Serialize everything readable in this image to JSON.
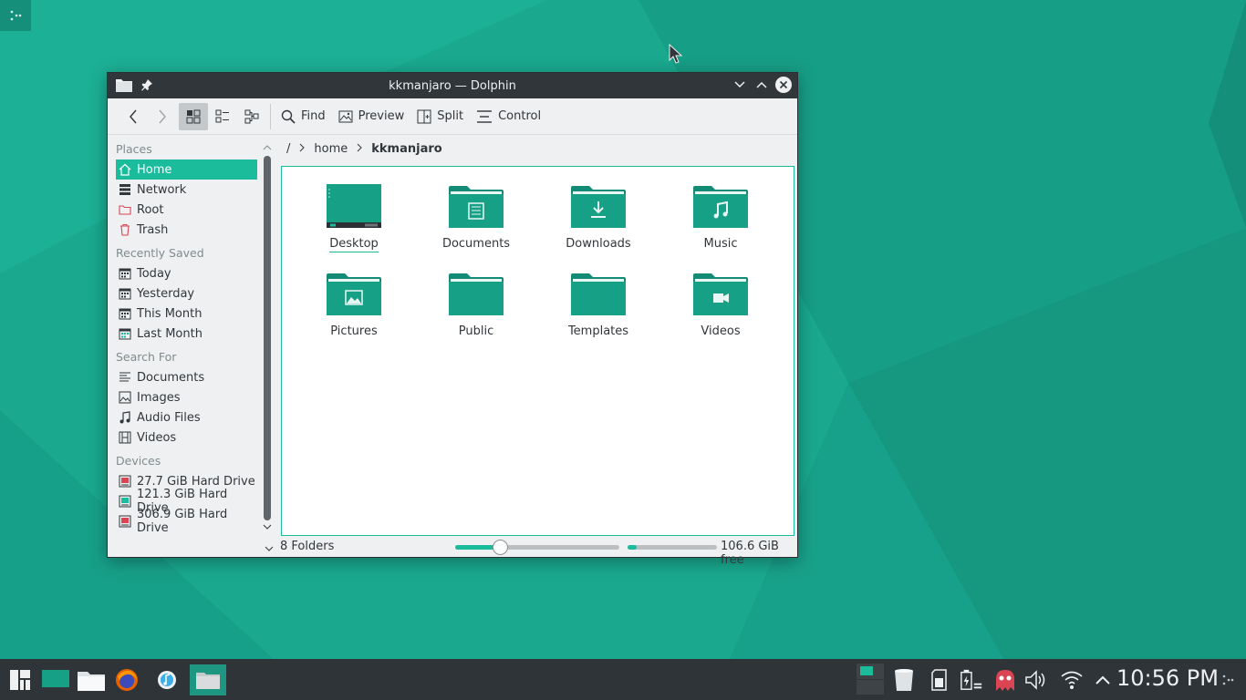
{
  "window": {
    "title": "kkmanjaro — Dolphin"
  },
  "toolbar": {
    "find_label": "Find",
    "preview_label": "Preview",
    "split_label": "Split",
    "control_label": "Control"
  },
  "sidebar": {
    "places_title": "Places",
    "places": [
      {
        "label": "Home",
        "icon": "home-icon"
      },
      {
        "label": "Network",
        "icon": "network-icon"
      },
      {
        "label": "Root",
        "icon": "folder-red-icon"
      },
      {
        "label": "Trash",
        "icon": "trash-icon"
      }
    ],
    "recent_title": "Recently Saved",
    "recent": [
      {
        "label": "Today",
        "icon": "calendar-icon"
      },
      {
        "label": "Yesterday",
        "icon": "calendar-icon"
      },
      {
        "label": "This Month",
        "icon": "calendar-icon"
      },
      {
        "label": "Last Month",
        "icon": "calendar-icon"
      }
    ],
    "search_title": "Search For",
    "search": [
      {
        "label": "Documents",
        "icon": "text-lines-icon"
      },
      {
        "label": "Images",
        "icon": "image-icon"
      },
      {
        "label": "Audio Files",
        "icon": "music-note-icon"
      },
      {
        "label": "Videos",
        "icon": "film-icon"
      }
    ],
    "devices_title": "Devices",
    "devices": [
      {
        "label": "27.7 GiB Hard Drive",
        "icon": "hard-drive-icon"
      },
      {
        "label": "121.3 GiB Hard Drive",
        "icon": "hard-drive-icon"
      },
      {
        "label": "306.9 GiB Hard Drive",
        "icon": "hard-drive-icon"
      }
    ]
  },
  "breadcrumb": {
    "root": "/",
    "home": "home",
    "current": "kkmanjaro"
  },
  "folders": [
    {
      "label": "Desktop",
      "icon": "desktop-folder-icon"
    },
    {
      "label": "Documents",
      "icon": "documents-folder-icon"
    },
    {
      "label": "Downloads",
      "icon": "downloads-folder-icon"
    },
    {
      "label": "Music",
      "icon": "music-folder-icon"
    },
    {
      "label": "Pictures",
      "icon": "pictures-folder-icon"
    },
    {
      "label": "Public",
      "icon": "folder-icon"
    },
    {
      "label": "Templates",
      "icon": "templates-folder-icon"
    },
    {
      "label": "Videos",
      "icon": "videos-folder-icon"
    }
  ],
  "status": {
    "summary": "8 Folders",
    "zoom_fraction": 0.27,
    "space_used_fraction": 0.1,
    "free_space": "106.6 GiB free"
  },
  "taskbar": {
    "clock": "10:56 PM"
  },
  "colors": {
    "accent": "#1abc9c",
    "folder": "#16a085",
    "desktop": "#1aa98f",
    "titlebar": "#31363b"
  }
}
